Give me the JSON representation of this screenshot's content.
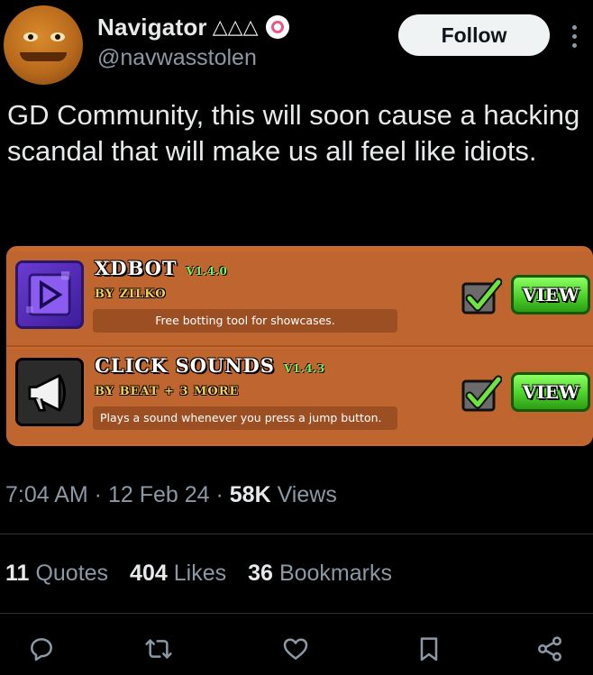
{
  "author": {
    "display_name": "Navigator",
    "name_badges": "△△△",
    "handle": "@navwasstolen"
  },
  "follow_label": "Follow",
  "tweet_text": "GD Community, this will soon cause a hacking scandal that will make us all feel like idiots.",
  "mods": [
    {
      "title": "XDBOT",
      "version": "V1.4.0",
      "author": "BY ZILKO",
      "description": "Free botting tool for showcases.",
      "view_label": "VIEW",
      "icon": "xdbot-logo-icon"
    },
    {
      "title": "CLICK SOUNDS",
      "version": "V1.4.3",
      "author": "BY BEAT + 3 MORE",
      "description": "Plays a sound whenever you press a jump button.",
      "view_label": "VIEW",
      "icon": "megaphone-icon"
    }
  ],
  "meta": {
    "time": "7:04 AM",
    "dot1": " · ",
    "date": "12 Feb 24",
    "dot2": " · ",
    "views_count": "58K",
    "views_label": " Views"
  },
  "stats": {
    "quotes_count": "11",
    "quotes_label": "Quotes",
    "likes_count": "404",
    "likes_label": "Likes",
    "bookmarks_count": "36",
    "bookmarks_label": "Bookmarks"
  },
  "colors": {
    "background": "#000000",
    "text_primary": "#e7e9ea",
    "text_secondary": "#8b98a5",
    "mod_panel": "#c7692f",
    "view_button": "#4cd12a"
  },
  "action_icons": [
    "reply-icon",
    "retweet-icon",
    "like-icon",
    "bookmark-icon",
    "share-icon"
  ]
}
